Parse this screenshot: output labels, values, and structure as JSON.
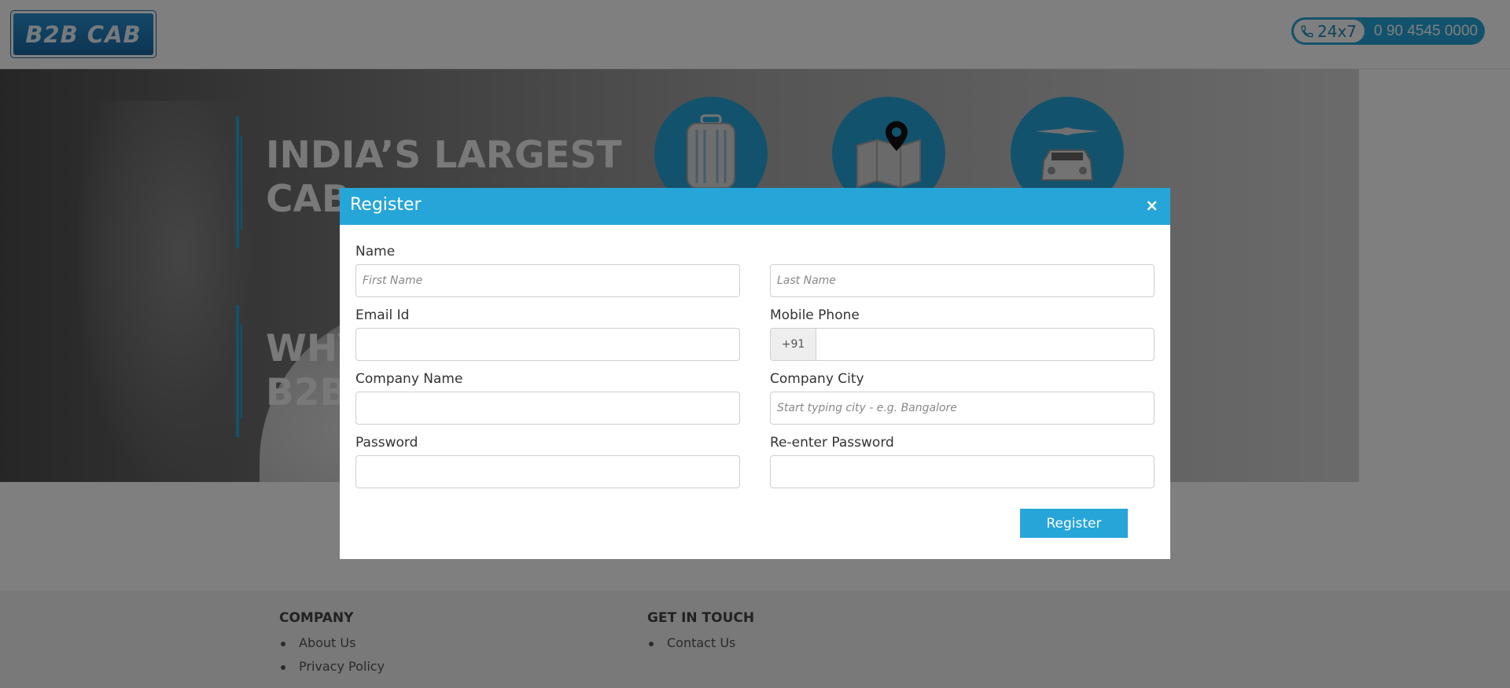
{
  "header": {
    "logo_text": "B2B CAB",
    "phone_tag": "24x7",
    "phone_number": "0 90 4545 0000",
    "accent_color": "#26a5d8"
  },
  "hero": {
    "heading_1": [
      "INDIA’S LARGEST",
      "CAB"
    ],
    "heading_2": [
      "WHY",
      "B2B"
    ],
    "icons": [
      "luggage-icon",
      "map-pin-icon",
      "airport-car-icon"
    ]
  },
  "footer": {
    "company_heading": "COMPANY",
    "company_links": [
      "About Us",
      "Privacy Policy"
    ],
    "contact_heading": "GET IN TOUCH",
    "contact_links": [
      "Contact Us"
    ]
  },
  "modal": {
    "title": "Register",
    "close_label": "×",
    "name_label": "Name",
    "first_name_placeholder": "First Name",
    "last_name_placeholder": "Last Name",
    "email_label": "Email Id",
    "mobile_label": "Mobile Phone",
    "mobile_prefix": "+91",
    "company_label": "Company Name",
    "city_label": "Company City",
    "city_placeholder": "Start typing city - e.g. Bangalore",
    "password_label": "Password",
    "reenter_label": "Re-enter Password",
    "submit_label": "Register"
  }
}
